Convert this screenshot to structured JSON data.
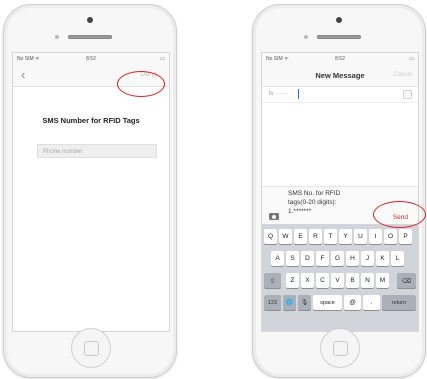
{
  "left_phone": {
    "status": {
      "carrier": "No SIM ᯤ",
      "time": "8:52"
    },
    "nav": {
      "back": "‹",
      "done": "Done"
    },
    "heading": "SMS Number for RFID Tags",
    "field": {
      "placeholder": "Phone number"
    }
  },
  "right_phone": {
    "status": {
      "carrier": "No SIM ᯤ",
      "time": "8:52"
    },
    "nav": {
      "title": "New Message",
      "cancel": "Cancel"
    },
    "to_field": {
      "label": "To: ·······"
    },
    "message": {
      "lines": [
        "SMS No. for RFID",
        "tags(0-20 digits):",
        "1.*******"
      ],
      "send": "Send"
    },
    "keyboard": {
      "row1": [
        "Q",
        "W",
        "E",
        "R",
        "T",
        "Y",
        "U",
        "I",
        "O",
        "P"
      ],
      "row2": [
        "A",
        "S",
        "D",
        "F",
        "G",
        "H",
        "J",
        "K",
        "L"
      ],
      "row3": [
        "Z",
        "X",
        "C",
        "V",
        "B",
        "N",
        "M"
      ],
      "shift": "⇧",
      "delete": "⌫",
      "numbers": "123",
      "globe": "🌐",
      "mic": "🎙",
      "space": "space",
      "at": "@",
      "dot": ".",
      "return": "return"
    }
  },
  "colors": {
    "highlight": "#d8232a",
    "send_text": "#d8232a"
  }
}
